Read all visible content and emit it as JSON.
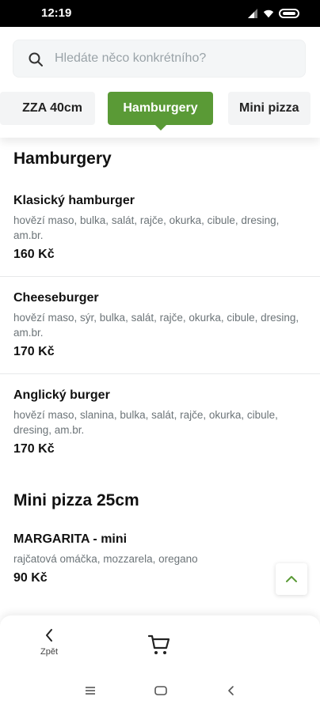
{
  "status_bar": {
    "time": "12:19",
    "icons": [
      "signal-icon",
      "wifi-icon",
      "battery-icon"
    ]
  },
  "search": {
    "placeholder": "Hledáte něco konkrétního?"
  },
  "categories": [
    {
      "label": "ZZA 40cm",
      "active": false
    },
    {
      "label": "Hamburgery",
      "active": true
    },
    {
      "label": "Mini pizza",
      "active": false
    }
  ],
  "sections": [
    {
      "title": "Hamburgery",
      "items": [
        {
          "name": "Klasický hamburger",
          "desc": "hovězí maso, bulka, salát, rajče, okurka, cibule, dresing, am.br.",
          "price": "160 Kč"
        },
        {
          "name": "Cheeseburger",
          "desc": "hovězí maso, sýr, bulka, salát, rajče, okurka, cibule, dresing, am.br.",
          "price": "170 Kč"
        },
        {
          "name": "Anglický burger",
          "desc": "hovězí maso, slanina, bulka, salát, rajče, okurka, cibule, dresing, am.br.",
          "price": "170 Kč"
        }
      ]
    },
    {
      "title": "Mini pizza 25cm",
      "items": [
        {
          "name": "MARGARITA - mini",
          "desc": "rajčatová omáčka, mozzarela, oregano",
          "price": "90 Kč"
        }
      ]
    }
  ],
  "bottom_bar": {
    "back_label": "Zpět",
    "cart_icon": "cart-icon"
  },
  "colors": {
    "accent": "#5a9a36",
    "scroll_arrow": "#5a9a36"
  }
}
